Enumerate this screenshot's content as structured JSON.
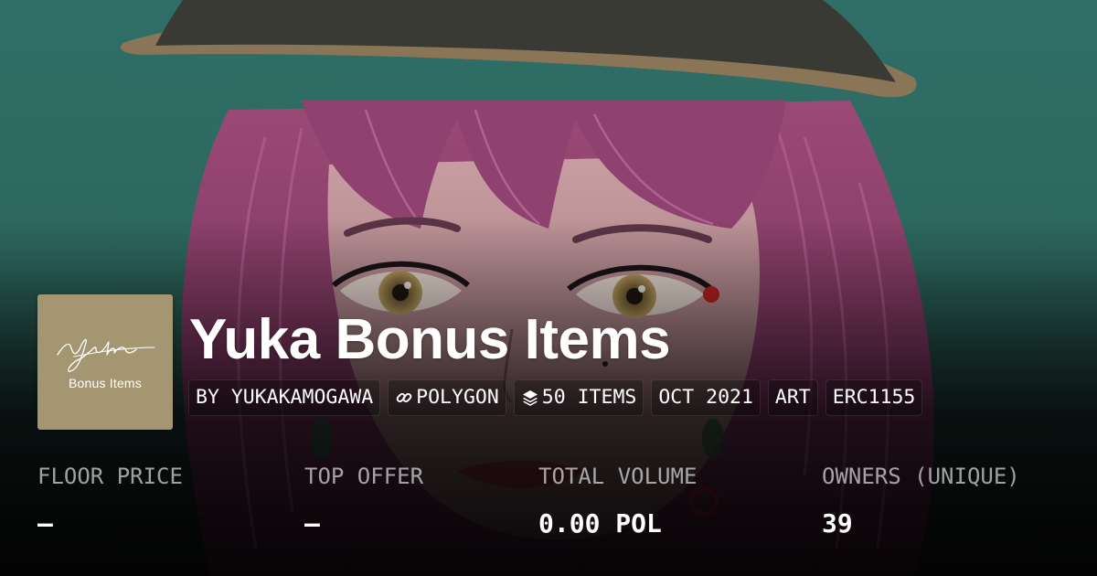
{
  "collection": {
    "title": "Yuka Bonus Items",
    "logo_script": "yuka",
    "logo_subtitle": "Bonus Items",
    "logo_color": "#a49670"
  },
  "tags": {
    "creator": "BY YUKAKAMOGAWA",
    "chain": "POLYGON",
    "chain_icon": "link-icon",
    "items": "50 ITEMS",
    "items_icon": "layers-icon",
    "date": "OCT 2021",
    "category": "ART",
    "standard": "ERC1155"
  },
  "stats": [
    {
      "label": "FLOOR PRICE",
      "value": "–"
    },
    {
      "label": "TOP OFFER",
      "value": "–"
    },
    {
      "label": "TOTAL VOLUME",
      "value": "0.00 POL"
    },
    {
      "label": "OWNERS (UNIQUE)",
      "value": "39"
    }
  ],
  "colors": {
    "background_teal": "#2f6c64",
    "hair": "#8e3f6a",
    "hat": "#3a3a34",
    "hat_band": "#8a7656",
    "text_primary": "#ffffff",
    "text_muted": "#a3a3a3"
  }
}
